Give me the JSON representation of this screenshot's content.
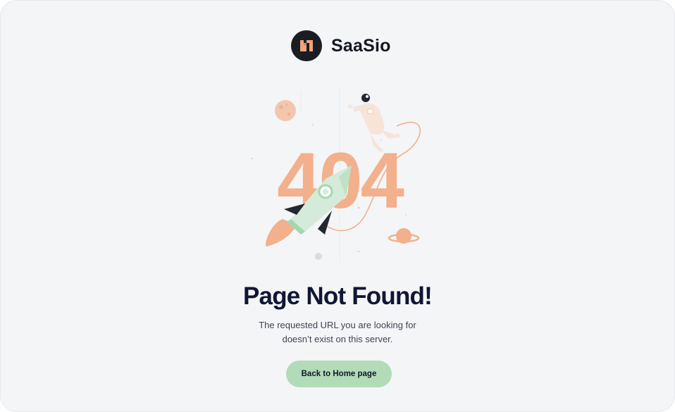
{
  "brand": {
    "name": "SaaSio",
    "logo_icon": "saasio-logo-icon"
  },
  "illustration": {
    "code": "404",
    "icons": [
      "astronaut-icon",
      "rocket-icon",
      "moon-icon",
      "planet-icon"
    ]
  },
  "error": {
    "title": "Page Not Found!",
    "description_line1": "The requested URL you are looking for",
    "description_line2": "doesn’t exist on this server."
  },
  "actions": {
    "home_button": "Back to Home page"
  },
  "colors": {
    "background": "#f4f5f7",
    "accent_orange": "#f2b08c",
    "button_green": "#b2dbb8",
    "heading": "#101733",
    "logo_dark": "#1a1d22"
  }
}
